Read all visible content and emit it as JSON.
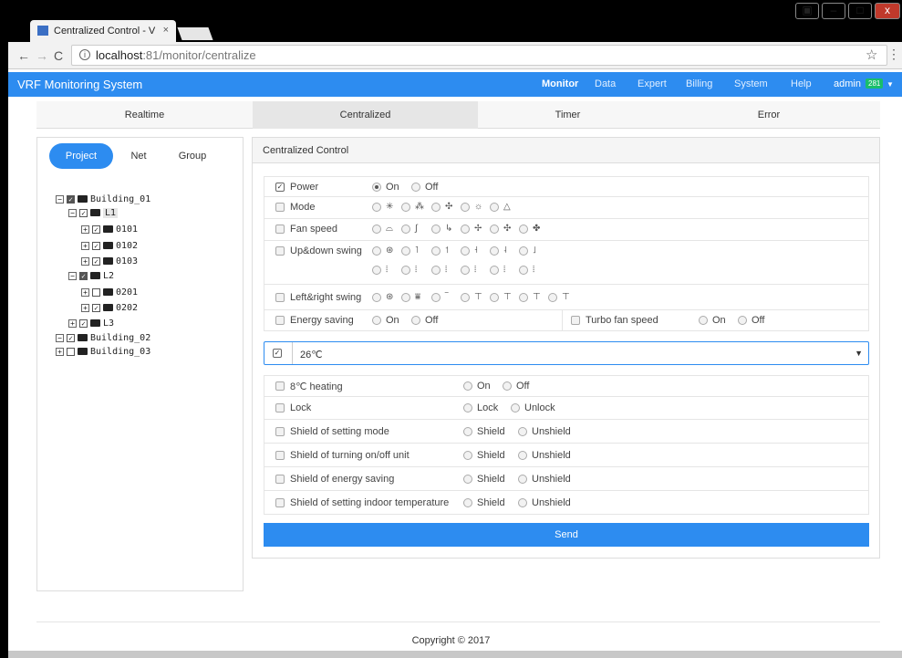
{
  "browser": {
    "tab_title": "Centralized Control - V",
    "tab_close": "×",
    "url_host": "localhost",
    "url_path": ":81/monitor/centralize",
    "win_min": "–",
    "win_max": "□",
    "win_close": "x"
  },
  "app": {
    "brand": "VRF Monitoring System",
    "nav": [
      "Monitor",
      "Data",
      "Expert",
      "Billing",
      "System",
      "Help"
    ],
    "user": "admin",
    "user_badge": "281"
  },
  "subtabs": [
    "Realtime",
    "Centralized",
    "Timer",
    "Error"
  ],
  "left": {
    "pills": [
      "Project",
      "Net",
      "Group"
    ],
    "tree": [
      "Building_01",
      "L1",
      "0101",
      "0102",
      "0103",
      "L2",
      "0201",
      "0202",
      "L3",
      "Building_02",
      "Building_03"
    ]
  },
  "panel": {
    "title": "Centralized Control",
    "rows": {
      "power": "Power",
      "mode": "Mode",
      "fan": "Fan speed",
      "updown": "Up&down swing",
      "leftright": "Left&right swing",
      "energy": "Energy saving",
      "turbo": "Turbo fan speed"
    },
    "on": "On",
    "off": "Off",
    "temperature": "26℃",
    "lower_rows": [
      {
        "label": "8℃ heating",
        "a": "On",
        "b": "Off"
      },
      {
        "label": "Lock",
        "a": "Lock",
        "b": "Unlock"
      },
      {
        "label": "Shield of setting mode",
        "a": "Shield",
        "b": "Unshield"
      },
      {
        "label": "Shield of turning on/off unit",
        "a": "Shield",
        "b": "Unshield"
      },
      {
        "label": "Shield of energy saving",
        "a": "Shield",
        "b": "Unshield"
      },
      {
        "label": "Shield of setting indoor temperature",
        "a": "Shield",
        "b": "Unshield"
      }
    ],
    "send": "Send"
  },
  "footer": "Copyright © 2017",
  "colors": {
    "accent": "#2d8cf0",
    "badge": "#19be6b"
  }
}
